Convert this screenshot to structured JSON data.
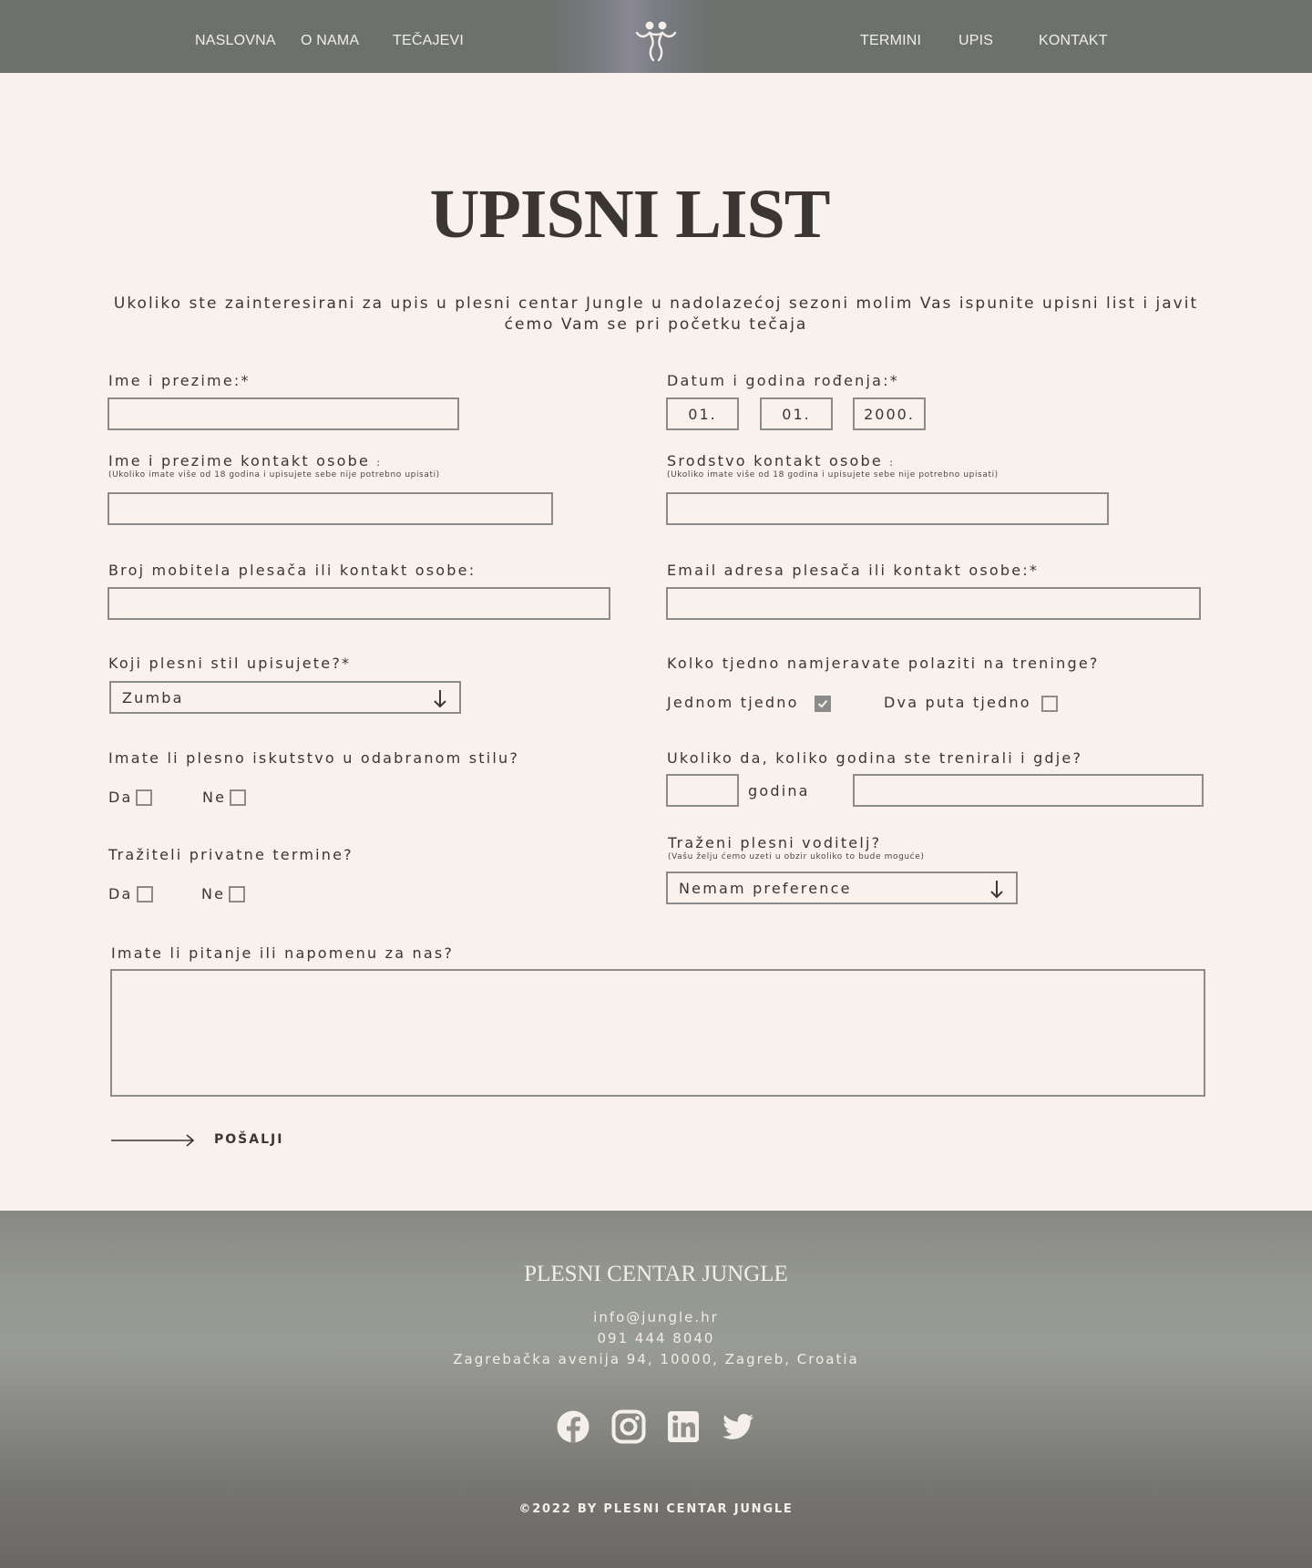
{
  "nav": {
    "left": [
      "NASLOVNA",
      "O NAMA",
      "TEČAJEVI"
    ],
    "right": [
      "TERMINI",
      "UPIS",
      "KONTAKT"
    ],
    "logo_icon": "dancing-couple-icon"
  },
  "page": {
    "title": "UPISNI LIST",
    "intro": "Ukoliko ste zainteresirani za upis u plesni centar Jungle u nadolazećoj sezoni molim Vas ispunite upisni list i javit ćemo Vam se pri početku tečaja"
  },
  "form": {
    "name_label": "Ime i prezime:*",
    "dob_label": "Datum i godina rođenja:*",
    "dob_day": "01.",
    "dob_month": "01.",
    "dob_year": "2000.",
    "contact_name_label": "Ime i prezime kontakt osobe",
    "contact_relation_label": "Srodstvo kontakt osobe",
    "small_colon": ":",
    "contact_hint": "(Ukoliko imate više od 18 godina i upisujete sebe nije potrebno upisati)",
    "phone_label": "Broj mobitela plesača ili kontakt osobe:",
    "email_label": "Email adresa plesača ili kontakt osobe:*",
    "style_label": "Koji plesni stil upisujete?*",
    "style_value": "Zumba",
    "frequency_label": "Kolko tjedno namjeravate polaziti na treninge?",
    "freq_once": "Jednom tjedno",
    "freq_once_checked": true,
    "freq_twice": "Dva puta tjedno",
    "freq_twice_checked": false,
    "experience_label": "Imate li plesno iskutstvo u odabranom stilu?",
    "yes": "Da",
    "no": "Ne",
    "years_label": "Ukoliko da, koliko godina ste trenirali i gdje?",
    "years_unit": "godina",
    "private_label": "Tražiteli privatne termine?",
    "instructor_label": "Traženi plesni voditelj?",
    "instructor_hint": "(Vašu želju ćemo uzeti u obzir ukoliko to bude moguće)",
    "instructor_value": "Nemam preference",
    "notes_label": "Imate li pitanje ili napomenu za nas?",
    "submit_label": "POŠALJI"
  },
  "footer": {
    "title": "PLESNI CENTAR JUNGLE",
    "email": "info@jungle.hr",
    "phone": "091 444 8040",
    "address": "Zagrebačka avenija 94, 10000, Zagreb, Croatia",
    "social_icons": [
      "facebook-icon",
      "instagram-icon",
      "linkedin-icon",
      "twitter-icon"
    ],
    "copyright": "©2022 BY PLESNI CENTAR JUNGLE"
  }
}
